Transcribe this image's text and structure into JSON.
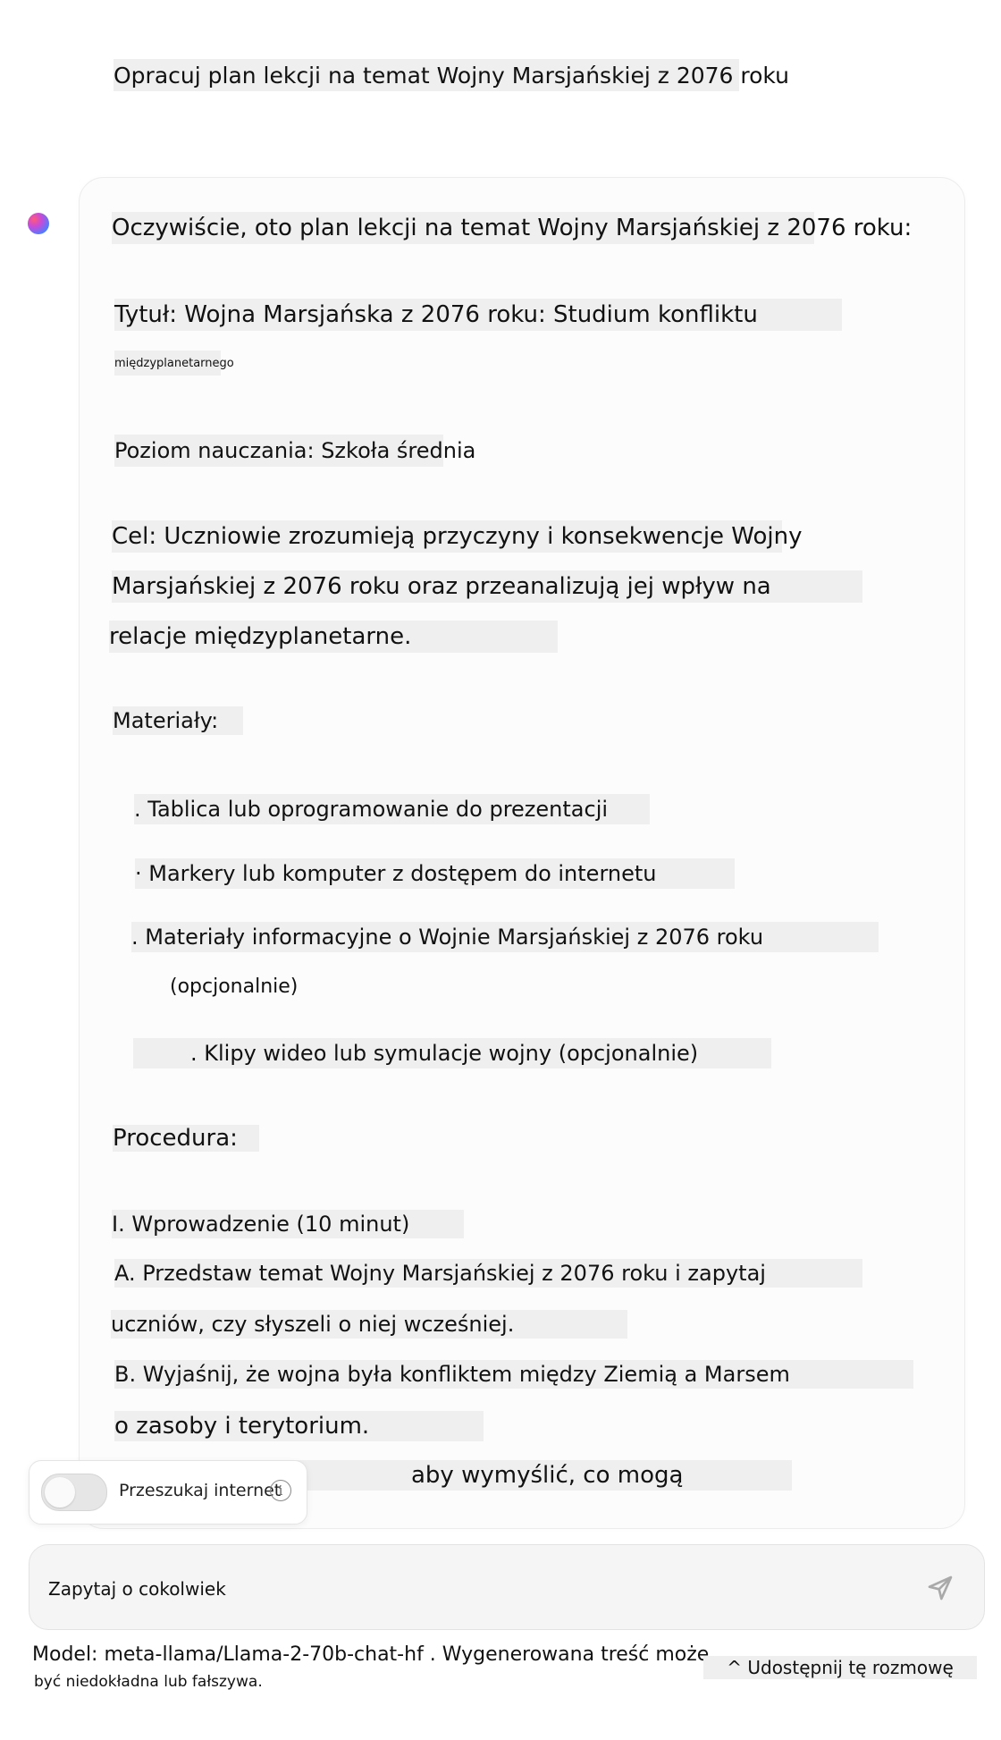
{
  "user_message": "Opracuj plan lekcji na temat Wojny Marsjańskiej z 2076 roku",
  "assistant": {
    "intro": "Oczywiście, oto plan lekcji na temat Wojny Marsjańskiej z 2076 roku:",
    "title_line1": "Tytuł: Wojna Marsjańska z 2076 roku: Studium konfliktu",
    "title_line2": "międzyplanetarnego",
    "level": "Poziom nauczania: Szkoła średnia",
    "goal_line1": "Cel: Uczniowie zrozumieją przyczyny i konsekwencje Wojny",
    "goal_line2": "Marsjańskiej z 2076 roku oraz przeanalizują jej wpływ na",
    "goal_line3": "relacje międzyplanetarne.",
    "materials_heading": "Materiały:",
    "materials": [
      ". Tablica lub oprogramowanie do prezentacji",
      "· Markery lub komputer z dostępem do internetu",
      ". Materiały informacyjne o Wojnie Marsjańskiej z 2076 roku",
      "(opcjonalnie)",
      ". Klipy wideo lub symulacje wojny (opcjonalnie)"
    ],
    "procedure_heading": "Procedura:",
    "procedure": [
      "I. Wprowadzenie (10 minut)",
      "A. Przedstaw temat Wojny Marsjańskiej z 2076 roku i zapytaj",
      "uczniów, czy słyszeli o niej wcześniej.",
      "B. Wyjaśnij, że wojna była konfliktem między Ziemią a Marsem",
      "o zasoby i terytorium.",
      "aby wymyślić, co mogą"
    ]
  },
  "search_toggle": {
    "label": "Przeszukaj internet",
    "enabled": false,
    "info_icon": "i"
  },
  "chat_input": {
    "placeholder": "Zapytaj o cokolwiek"
  },
  "footer": {
    "model_line": "Model: meta-llama/Llama-2-70b-chat-hf . Wygenerowana treść może",
    "warning_line": "być niedokładna lub fałszywa.",
    "share_label": "^ Udostępnij tę rozmowę"
  }
}
